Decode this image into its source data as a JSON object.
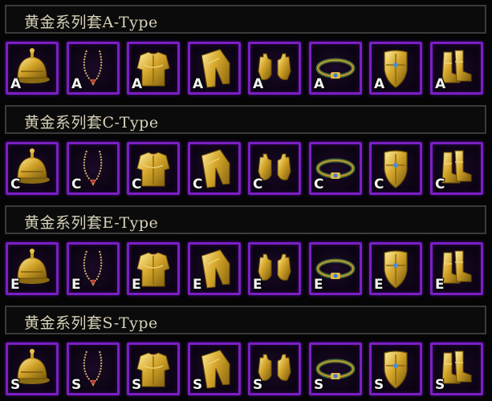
{
  "colors": {
    "slot_border": "#7a1fc4",
    "gold": "#d4a52a",
    "title_text": "#d8d2b8"
  },
  "sets": [
    {
      "title": "黄金系列套A-Type",
      "grade": "A",
      "items": [
        {
          "name": "helmet-icon"
        },
        {
          "name": "necklace-icon"
        },
        {
          "name": "armor-icon"
        },
        {
          "name": "pants-icon"
        },
        {
          "name": "gloves-icon"
        },
        {
          "name": "belt-icon"
        },
        {
          "name": "shield-icon"
        },
        {
          "name": "boots-icon"
        }
      ]
    },
    {
      "title": "黄金系列套C-Type",
      "grade": "C",
      "items": [
        {
          "name": "helmet-icon"
        },
        {
          "name": "necklace-icon"
        },
        {
          "name": "armor-icon"
        },
        {
          "name": "pants-icon"
        },
        {
          "name": "gloves-icon"
        },
        {
          "name": "belt-icon"
        },
        {
          "name": "shield-icon"
        },
        {
          "name": "boots-icon"
        }
      ]
    },
    {
      "title": "黄金系列套E-Type",
      "grade": "E",
      "items": [
        {
          "name": "helmet-icon"
        },
        {
          "name": "necklace-icon"
        },
        {
          "name": "armor-icon"
        },
        {
          "name": "pants-icon"
        },
        {
          "name": "gloves-icon"
        },
        {
          "name": "belt-icon"
        },
        {
          "name": "shield-icon"
        },
        {
          "name": "boots-icon"
        }
      ]
    },
    {
      "title": "黄金系列套S-Type",
      "grade": "S",
      "items": [
        {
          "name": "helmet-icon"
        },
        {
          "name": "necklace-icon"
        },
        {
          "name": "armor-icon"
        },
        {
          "name": "pants-icon"
        },
        {
          "name": "gloves-icon"
        },
        {
          "name": "belt-icon"
        },
        {
          "name": "shield-icon"
        },
        {
          "name": "boots-icon"
        }
      ]
    }
  ]
}
